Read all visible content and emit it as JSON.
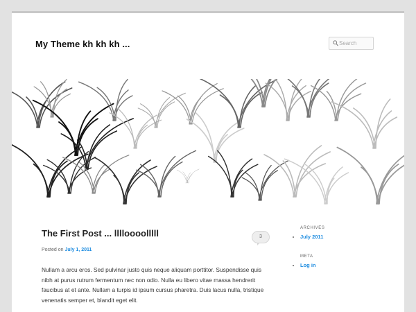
{
  "header": {
    "site_title": "My Theme kh kh kh ...",
    "search_placeholder": "Search"
  },
  "post": {
    "title": "The First Post ... lllloooolllll",
    "comment_count": "3",
    "posted_on_label": "Posted on",
    "date": "July 1, 2011",
    "body": "Nullam a arcu eros. Sed pulvinar justo quis neque aliquam porttitor. Suspendisse quis nibh at purus rutrum fermentum nec non odio. Nulla eu libero vitae massa hendrerit faucibus at et ante. Nullam a turpis id ipsum cursus pharetra. Duis lacus nulla, tristique venenatis semper et, blandit eget elit."
  },
  "sidebar": {
    "archives_title": "ARCHIVES",
    "archives": [
      "July 2011"
    ],
    "meta_title": "META",
    "meta": [
      "Log in"
    ]
  },
  "colors": {
    "link": "#1b8be0",
    "page_bg": "#ffffff",
    "outer_bg": "#e2e2e2"
  }
}
